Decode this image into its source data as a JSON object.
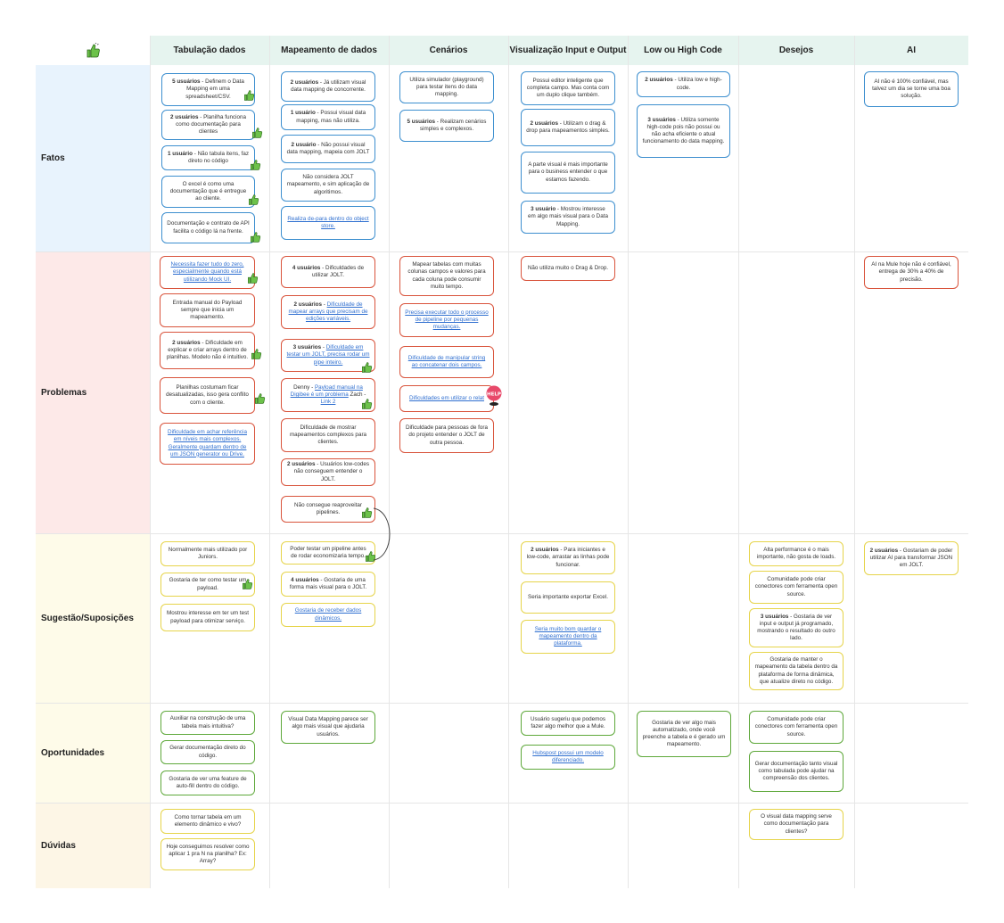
{
  "columns": [
    "Tabulação dados",
    "Mapeamento de dados",
    "Cenários",
    "Visualização Input e Output",
    "Low ou High Code",
    "Desejos",
    "AI"
  ],
  "rows": [
    "Fatos",
    "Problemas",
    "Sugestão/Suposições",
    "Oportunidades",
    "Dúvidas"
  ],
  "colors": {
    "fatos": "#e8f3fd",
    "problemas": "#fde9e8",
    "sugestao": "#fefbe9",
    "oportunidades": "#fefbe9",
    "duvidas": "#fdf6e6",
    "header": "#e6f4ef"
  },
  "icons": {
    "reaction": "thumbs-up-icon",
    "help": "help-sticker-icon"
  },
  "notes": {
    "t1": {
      "b": "5 usuários",
      "t": " - Definem o Data Mapping em uma spreadsheet/CSV."
    },
    "t2": {
      "b": "2 usuários",
      "t": " - Planilha funciona como documentação para clientes"
    },
    "t3": {
      "b": "1 usuário",
      "t": " - Não tabula itens, faz direto no código"
    },
    "t4": {
      "t": "O excel é como uma documentação que é entregue ao cliente."
    },
    "t5": {
      "t": "Documentação e contrato de API facilita o código lá na frente."
    },
    "m1": {
      "b": "2 usuários",
      "t": " - Já utilizam visual data mapping de concorrente."
    },
    "m2": {
      "b": "1 usuário",
      "t": " - Possui visual data mapping, mas não utiliza."
    },
    "m3": {
      "b": "2 usuário",
      "t": " - Não possui visual data mapping, mapeia com JOLT"
    },
    "m4": {
      "t": "Não considera JOLT mapeamento, e sim aplicação de algoritimos."
    },
    "m5": {
      "l": "Realiza de-para dentro do object store."
    },
    "c1": {
      "t": "Utiliza simulador (playground) para testar itens do data mapping."
    },
    "c2": {
      "b": "5 usuários",
      "t": " - Realizam cenários simples e complexos."
    },
    "v1": {
      "t": "Possui editor inteligente que completa campo. Mas conta com um duplo clique também."
    },
    "v2": {
      "b": "2 usuários",
      "t": " - Utilizam o drag & drop para mapeamentos simples."
    },
    "v3": {
      "t": "A parte visual é mais importante para o business entender o que estamos fazendo."
    },
    "v4": {
      "b": "3 usuário",
      "t": " - Mostrou interesse em algo mais visual para o Data Mapping."
    },
    "l1": {
      "b": "2 usuários",
      "t": " - Utiliza low e high-code."
    },
    "l2": {
      "b": "3 usuários",
      "t": " - Utiliza somente high-code pois não possui ou não acha eficiente o atual funcionamento do data mapping."
    },
    "a1": {
      "t": "AI não é 100% confiável, mas talvez um dia se torne uma boa solução."
    },
    "pt1": {
      "l": "Necessita fazer tudo do zero, especialmente quando está utilizando Mock UI."
    },
    "pt2": {
      "t": "Entrada manual do Payload sempre que inicia um mapeamento."
    },
    "pt3": {
      "b": "2 usuários",
      "t": " - Dificuldade em explicar e criar arrays dentro de planilhas. Modelo não é intuitivo."
    },
    "pt4": {
      "t": "Planilhas costumam ficar desatualizadas, isso gera conflito com o cliente."
    },
    "pt5": {
      "l": "Dificuldade em achar referência em níveis mais complexos. Geralmente guardam dentro de um JSON generator ou Drive."
    },
    "pm1": {
      "b": "4  usuários",
      "t": " - Dificuldades de utilizar JOLT."
    },
    "pm2": {
      "b": "2 usuários",
      "t": " - ",
      "l": "Dificuldade de mapear arrays que precisam de edições variáveis."
    },
    "pm3": {
      "b": "3 usuários",
      "t": " - ",
      "l": "Dificuldade em testar um JOLT, precisa rodar um pipe inteiro."
    },
    "pm4": {
      "t": "Denny - ",
      "l": "Payload manual na Digibee é um problema",
      "t2": " Zach - ",
      "l2": "Link 2"
    },
    "pm5": {
      "t": "Dificuldade de mostrar mapeamentos complexos para clientes."
    },
    "pm6": {
      "b": "2 usuários",
      "t": " - Usuários low-codes não conseguem entender o JOLT."
    },
    "pm7": {
      "t": "Não consegue reaproveitar pipelines."
    },
    "pc1": {
      "t": "Mapear tabelas com muitas colunas campos e valores para cada coluna pode consumir muito tempo."
    },
    "pc2": {
      "l": "Precisa executar todo o processo de pipeline por pequenas mudanças."
    },
    "pc3": {
      "l": "Dificuldade de manipular string ao concatenar dois campos."
    },
    "pc4": {
      "l": "Dificuldades em utilizar o relat"
    },
    "pc5": {
      "t": "Dificuldade para pessoas de fora do projeto entender o JOLT de outra pessoa."
    },
    "pv1": {
      "t": "Não utiliza muito o Drag & Drop."
    },
    "pa1": {
      "t": "AI na Mule hoje não é confiável, entrega de 30% a 40% de precisão."
    },
    "st1": {
      "t": "Normalmente mais utilizado por Juniors."
    },
    "st2": {
      "t": "Gostaria de ter como testar um payload."
    },
    "st3": {
      "t": "Mostrou interesse em ter um test payload para otimizar serviço."
    },
    "sm1": {
      "t": "Poder testar um pipeline antes de rodar economizaria tempo."
    },
    "sm2": {
      "b": "4 usuários",
      "t": " - Gostaria de uma forma mais visual para o JOLT."
    },
    "sm3": {
      "l": "Gostaria de receber dados dinâmicos."
    },
    "sv1": {
      "b": "2 usuários",
      "t": " - Para iniciantes e low-code, arrastar as linhas pode funcionar."
    },
    "sv2": {
      "t": "Seria importante exportar Excel."
    },
    "sv3": {
      "l": "Seria muito bom guardar o mapeamento dentro da plataforma."
    },
    "sd1": {
      "t": "Alta performance é o mais importante, não gosta de loads."
    },
    "sd2": {
      "t": "Comunidade pode criar conectores com ferramenta open source."
    },
    "sd3": {
      "b": "3 usuários",
      "t": " - Gostaria de ver input e output já programado, mostrando o resultado do outro lado."
    },
    "sd4": {
      "t": "Gostaria de manter o mapeamento da tabela dentro da plataforma de forma dinâmica, que atualize direto no código."
    },
    "sa1": {
      "b": "2 usuários",
      "t": " - Gostariam de poder utilizar AI para transformar JSON em JOLT."
    },
    "ot1": {
      "t": "Auxiliar na construção de uma tabela mais intuitiva?"
    },
    "ot2": {
      "t": "Gerar documentação direto do código."
    },
    "ot3": {
      "t": "Gostaria de ver uma feature de auto-fill dentro do código."
    },
    "om1": {
      "t": "Visual Data Mapping parece ser algo mais visual que ajudaria usuários."
    },
    "ov1": {
      "t": "Usuário sugeriu que podemos fazer algo melhor que a Mule."
    },
    "ov2": {
      "l": "Hubspost possui um modelo diferenciado."
    },
    "ol1": {
      "t": "Gostaria de ver algo mais automatizado, onde você preenche a tabela e é gerado um mapeamento."
    },
    "od1": {
      "t": "Comunidade pode criar conectores com ferramenta open source."
    },
    "od2": {
      "t": "Gerar documentação tanto visual como tabulada pode ajudar na compreensão dos clientes."
    },
    "dt1": {
      "t": "Como tornar tabela em um elemento dinâmico e vivo?"
    },
    "dt2": {
      "t": "Hoje conseguimos resolver como aplicar 1 pra N na planilha? Ex: Array?"
    },
    "dd1": {
      "t": "O visual data mapping serve como documentação para clientes?"
    }
  }
}
